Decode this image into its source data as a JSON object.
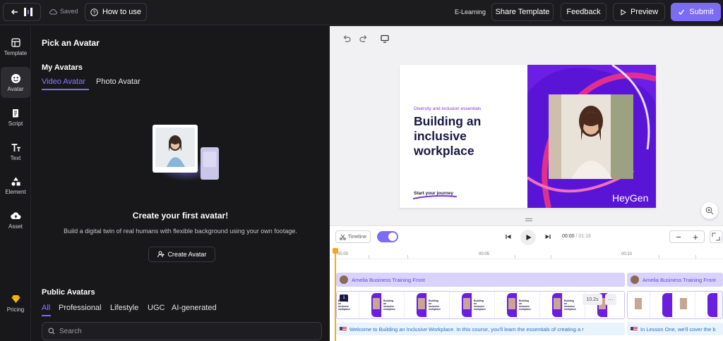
{
  "topbar": {
    "saved": "Saved",
    "how_to_use": "How to use",
    "category": "E-Learning",
    "share_template": "Share Template",
    "feedback": "Feedback",
    "preview": "Preview",
    "submit": "Submit",
    "accent_color": "#7c6cf5"
  },
  "rail": {
    "items": [
      {
        "label": "Template",
        "icon": "template-icon"
      },
      {
        "label": "Avatar",
        "icon": "avatar-icon"
      },
      {
        "label": "Script",
        "icon": "script-icon"
      },
      {
        "label": "Text",
        "icon": "text-icon"
      },
      {
        "label": "Element",
        "icon": "element-icon"
      },
      {
        "label": "Asset",
        "icon": "upload-cloud-icon"
      },
      {
        "label": "Pricing",
        "icon": "diamond-icon"
      }
    ],
    "active": "Avatar"
  },
  "panel": {
    "title": "Pick an Avatar",
    "my_avatars": "My Avatars",
    "tabs": [
      "Video Avatar",
      "Photo Avatar"
    ],
    "active_tab": "Video Avatar",
    "empty_title": "Create your first avatar!",
    "empty_subtitle": "Build a digital twin of real humans with flexible background using your own footage.",
    "create_button": "Create Avatar",
    "public_avatars": "Public Avatars",
    "filters": [
      "All",
      "Professional",
      "Lifestyle",
      "UGC",
      "AI-generated"
    ],
    "active_filter": "All",
    "search_placeholder": "Search"
  },
  "slide": {
    "kicker": "Diversity and inclusion essentials",
    "title": "Building an inclusive workplace",
    "cta": "Start your journey",
    "watermark": "HeyGen"
  },
  "timeline": {
    "toggle_label": "Timeline",
    "current_time": "00:00",
    "total_time": "/ 01:18",
    "zoom_minus": "−",
    "zoom_plus": "+",
    "ruler": [
      "00:00",
      "00:05",
      "00:10"
    ],
    "avatar_tracks": [
      "Amelia Business Training Front",
      "Amelia Business Training Front"
    ],
    "scene_number": "1",
    "scene_duration": "10.2s",
    "scene_more": "···",
    "thumb_text": "Building an inclusive workplace",
    "scripts": [
      "Welcome to Building an Inclusive Workplace. In this course, you'll learn the essentials of creating a r",
      "In Lesson One, we'll cover the b"
    ]
  }
}
